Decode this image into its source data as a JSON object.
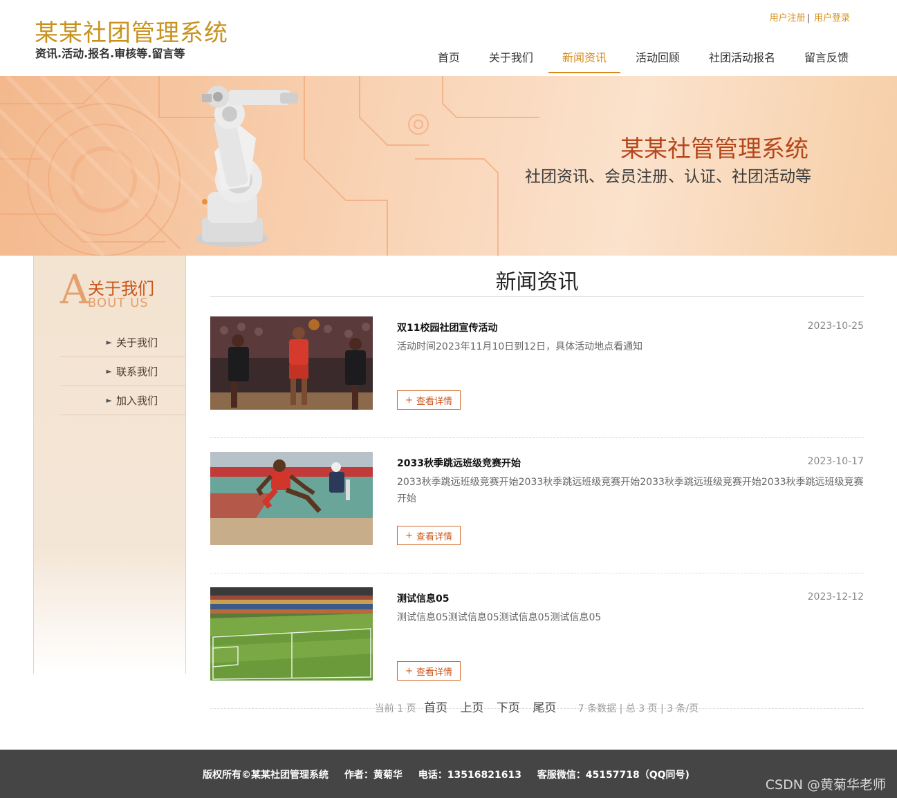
{
  "header": {
    "site_title": "某某社团管理系统",
    "site_subtitle": "资讯.活动.报名.审核等.留言等",
    "register_label": "用户注册",
    "separator": "|",
    "login_label": "用户登录"
  },
  "nav": {
    "items": [
      {
        "label": "首页"
      },
      {
        "label": "关于我们"
      },
      {
        "label": "新闻资讯"
      },
      {
        "label": "活动回顾"
      },
      {
        "label": "社团活动报名"
      },
      {
        "label": "留言反馈"
      }
    ],
    "active_index": 2
  },
  "banner": {
    "title": "某某社管管理系统",
    "subtitle": "社团资讯、会员注册、认证、社团活动等"
  },
  "sidebar": {
    "big_letter": "A",
    "title_cn": "关于我们",
    "title_en": "BOUT US",
    "items": [
      {
        "label": "关于我们"
      },
      {
        "label": "联系我们"
      },
      {
        "label": "加入我们"
      }
    ]
  },
  "main": {
    "section_title": "新闻资讯",
    "detail_label": "查看详情",
    "detail_plus": "+",
    "news": [
      {
        "title": "双11校园社团宣传活动",
        "date": "2023-10-25",
        "summary": "活动时间2023年11月10日到12日，具体活动地点看通知",
        "image": "basketball-photo"
      },
      {
        "title": "2033秋季跳远班级竞赛开始",
        "date": "2023-10-17",
        "summary": "2033秋季跳远班级竞赛开始2033秋季跳远班级竞赛开始2033秋季跳远班级竞赛开始2033秋季跳远班级竞赛开始",
        "image": "long-jump-photo"
      },
      {
        "title": "测试信息05",
        "date": "2023-12-12",
        "summary": "测试信息05测试信息05测试信息05测试信息05",
        "image": "stadium-photo"
      }
    ]
  },
  "pagination": {
    "current_prefix": "当前",
    "current_page": "1",
    "current_suffix": "页",
    "first": "首页",
    "prev": "上页",
    "next": "下页",
    "last": "尾页",
    "info": "7 条数据 | 总 3 页 | 3 条/页"
  },
  "footer": {
    "copyright": "版权所有©某某社团管理系统",
    "author": "作者：黄菊华",
    "phone": "电话：13516821613",
    "wechat": "客服微信：45157718（QQ同号)",
    "watermark": "CSDN @黄菊华老师"
  },
  "colors": {
    "brand": "#c8921e",
    "accent": "#d9891a",
    "banner_title": "#b5471c",
    "footer_bg": "#454545"
  }
}
